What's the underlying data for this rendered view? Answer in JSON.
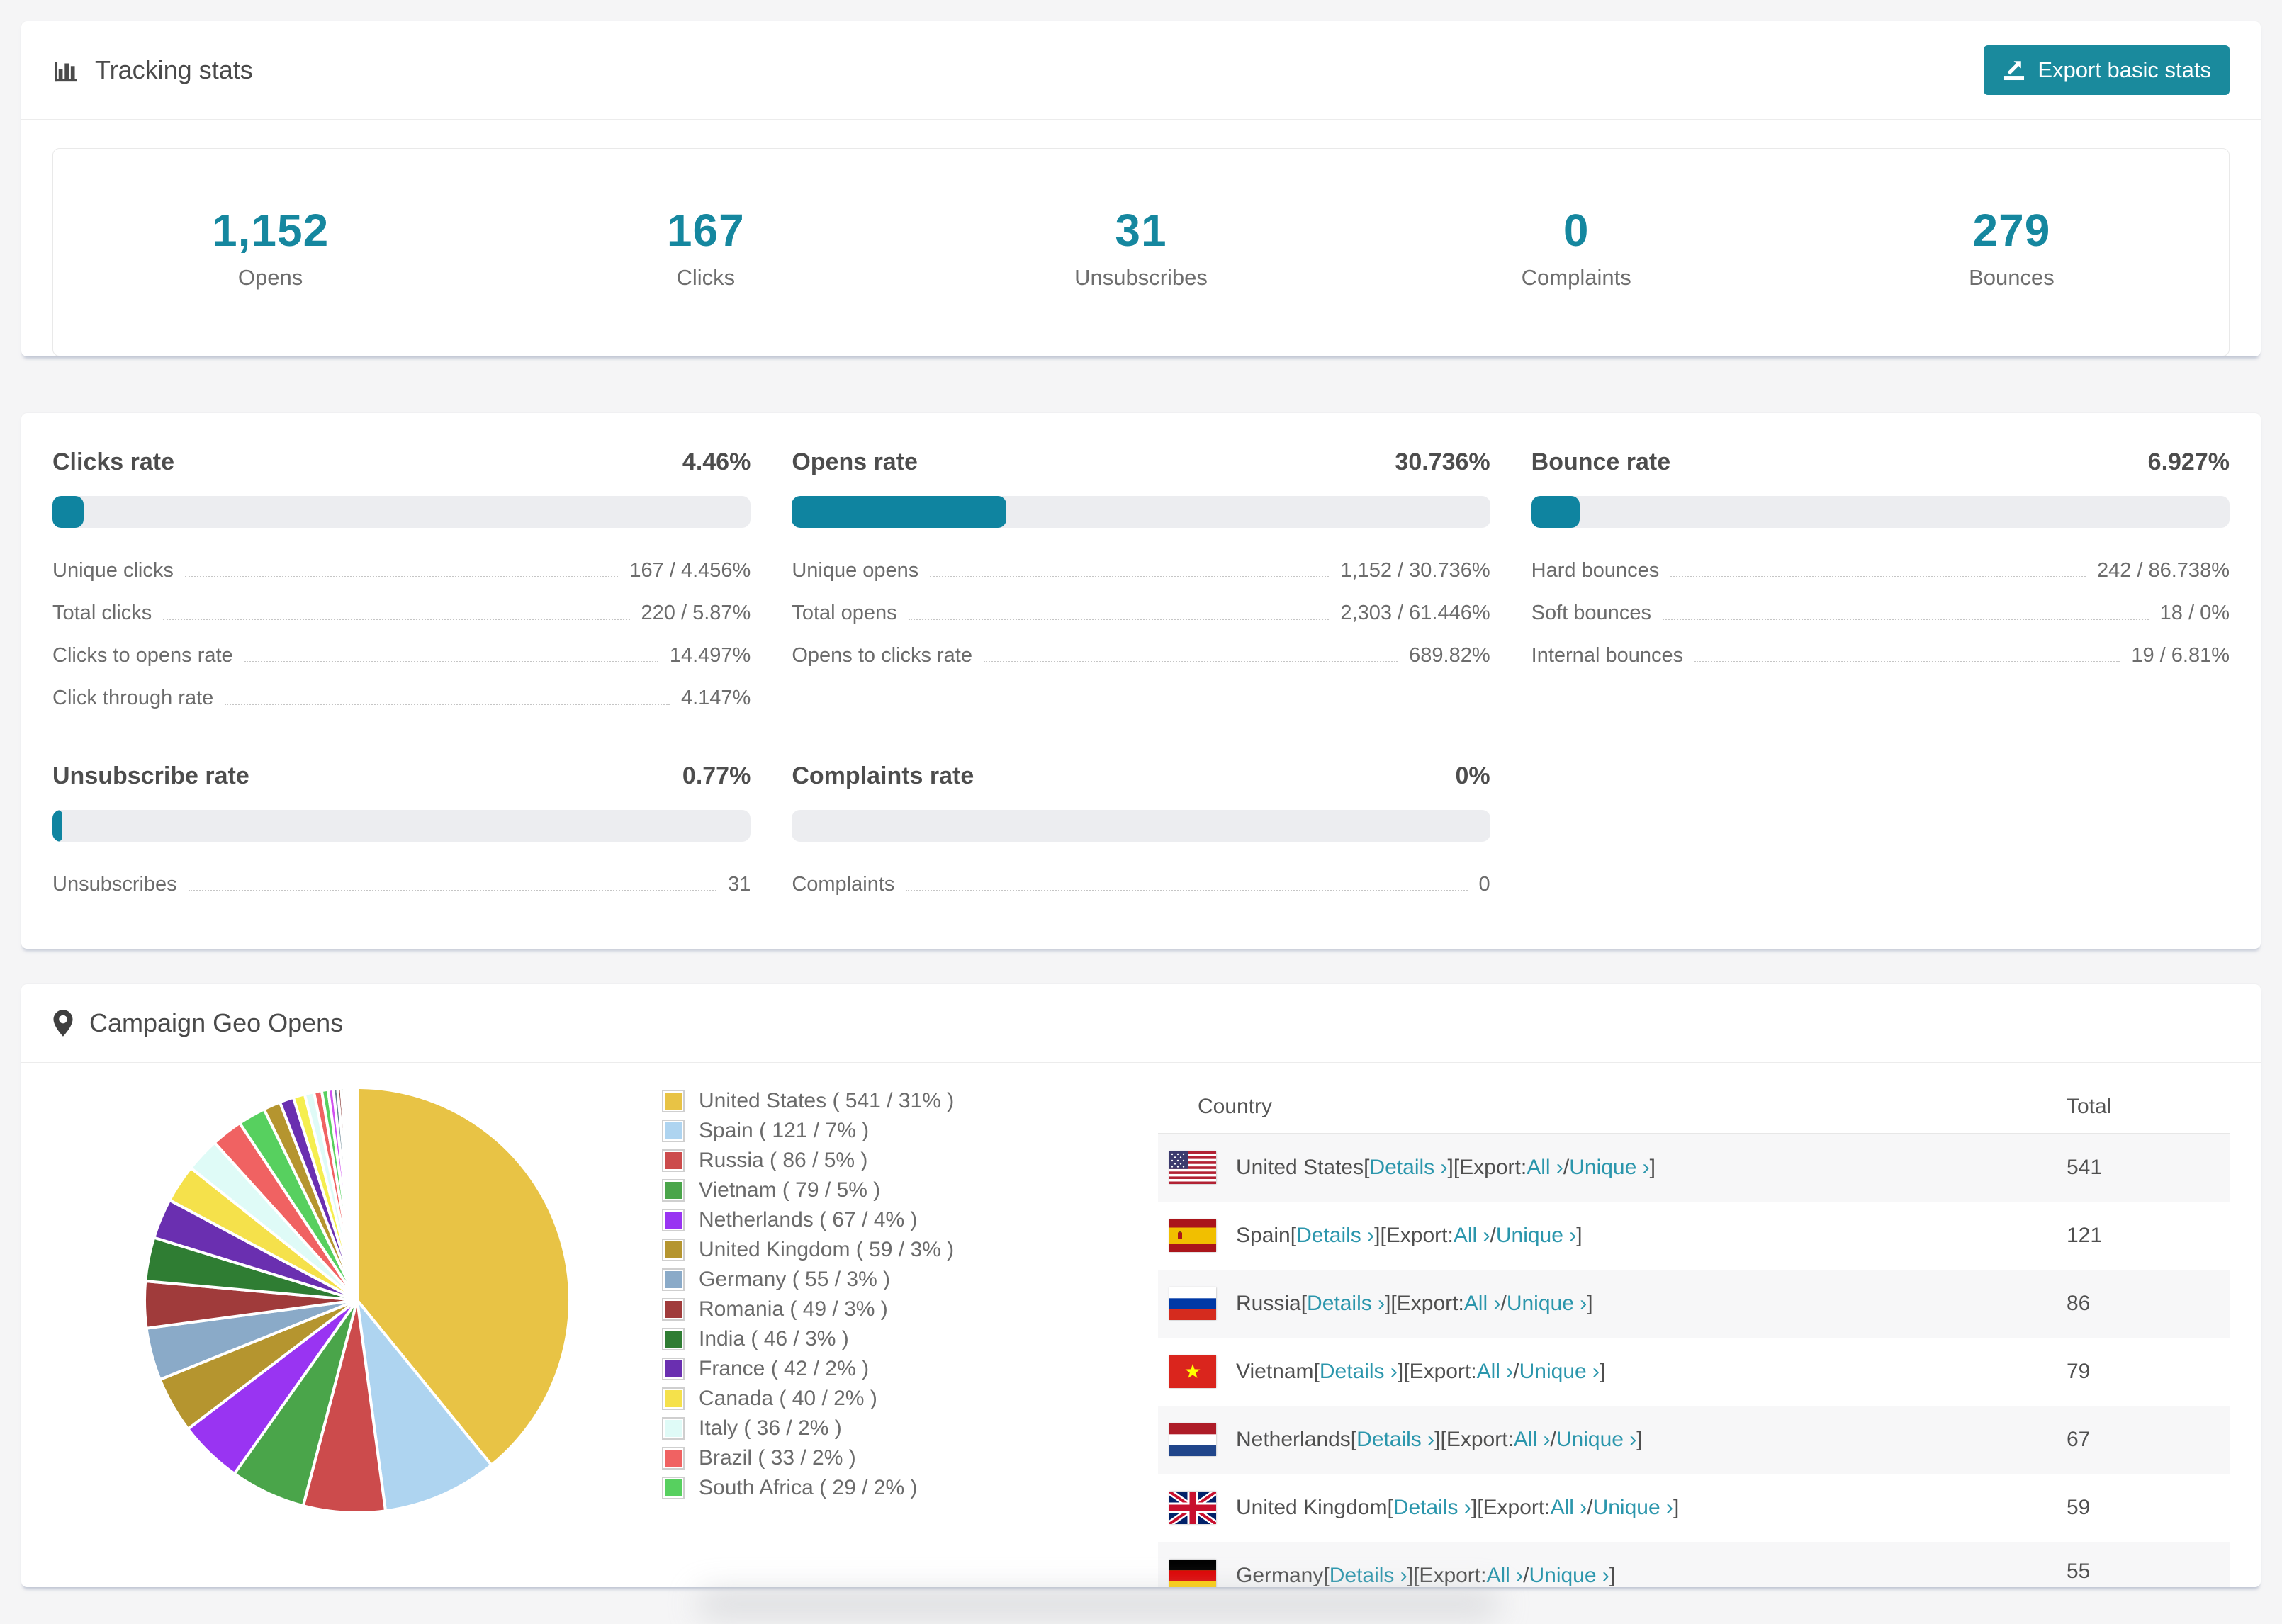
{
  "colors": {
    "accent": "#15879f",
    "button_bg": "#1a8a9d",
    "link": "#2b96ac",
    "bar_fill": "#0f84a0",
    "bar_track": "#ecedf0",
    "row_stripe": "#f7f7f8"
  },
  "tracking": {
    "title": "Tracking stats",
    "export_label": "Export basic stats"
  },
  "summary_stats": [
    {
      "value": "1,152",
      "label": "Opens"
    },
    {
      "value": "167",
      "label": "Clicks"
    },
    {
      "value": "31",
      "label": "Unsubscribes"
    },
    {
      "value": "0",
      "label": "Complaints"
    },
    {
      "value": "279",
      "label": "Bounces"
    }
  ],
  "rate_blocks": [
    {
      "id": "clicks-rate",
      "title": "Clicks rate",
      "value": "4.46%",
      "percent": 4.46,
      "rows": [
        {
          "label": "Unique clicks",
          "value": "167 / 4.456%"
        },
        {
          "label": "Total clicks",
          "value": "220 / 5.87%"
        },
        {
          "label": "Clicks to opens rate",
          "value": "14.497%"
        },
        {
          "label": "Click through rate",
          "value": "4.147%"
        }
      ]
    },
    {
      "id": "opens-rate",
      "title": "Opens rate",
      "value": "30.736%",
      "percent": 30.736,
      "rows": [
        {
          "label": "Unique opens",
          "value": "1,152 / 30.736%"
        },
        {
          "label": "Total opens",
          "value": "2,303 / 61.446%"
        },
        {
          "label": "Opens to clicks rate",
          "value": "689.82%"
        }
      ]
    },
    {
      "id": "bounce-rate",
      "title": "Bounce rate",
      "value": "6.927%",
      "percent": 6.927,
      "rows": [
        {
          "label": "Hard bounces",
          "value": "242 / 86.738%"
        },
        {
          "label": "Soft bounces",
          "value": "18 / 0%"
        },
        {
          "label": "Internal bounces",
          "value": "19 / 6.81%"
        }
      ]
    },
    {
      "id": "unsubscribe-rate",
      "title": "Unsubscribe rate",
      "value": "0.77%",
      "percent": 0.77,
      "rows": [
        {
          "label": "Unsubscribes",
          "value": "31"
        }
      ]
    },
    {
      "id": "complaints-rate",
      "title": "Complaints rate",
      "value": "0%",
      "percent": 0,
      "rows": [
        {
          "label": "Complaints",
          "value": "0"
        }
      ]
    }
  ],
  "geo": {
    "title": "Campaign Geo Opens",
    "table": {
      "country_header": "Country",
      "total_header": "Total",
      "details_label": "Details ›",
      "export_prefix": "[Export: ",
      "all_label": "All ›",
      "unique_label": "Unique ›",
      "rows": [
        {
          "country": "United States",
          "flag": "us",
          "total": "541",
          "partial": false
        },
        {
          "country": "Spain",
          "flag": "es",
          "total": "121",
          "partial": false
        },
        {
          "country": "Russia",
          "flag": "ru",
          "total": "86",
          "partial": false
        },
        {
          "country": "Vietnam",
          "flag": "vn",
          "total": "79",
          "partial": false
        },
        {
          "country": "Netherlands",
          "flag": "nl",
          "total": "67",
          "partial": false
        },
        {
          "country": "United Kingdom",
          "flag": "gb",
          "total": "59",
          "partial": false
        },
        {
          "country": "Germany",
          "flag": "de",
          "total": "55",
          "partial": true
        }
      ]
    }
  },
  "chart_data": {
    "type": "pie",
    "title": "Campaign Geo Opens",
    "legend_position": "right",
    "series": [
      {
        "name": "United States",
        "value": 541,
        "percent": 31,
        "color": "#e8c345"
      },
      {
        "name": "Spain",
        "value": 121,
        "percent": 7,
        "color": "#aed4f0"
      },
      {
        "name": "Russia",
        "value": 86,
        "percent": 5,
        "color": "#cc4b4c"
      },
      {
        "name": "Vietnam",
        "value": 79,
        "percent": 5,
        "color": "#4aa54a"
      },
      {
        "name": "Netherlands",
        "value": 67,
        "percent": 4,
        "color": "#9934f2"
      },
      {
        "name": "United Kingdom",
        "value": 59,
        "percent": 3,
        "color": "#b5952f"
      },
      {
        "name": "Germany",
        "value": 55,
        "percent": 3,
        "color": "#8aaac8"
      },
      {
        "name": "Romania",
        "value": 49,
        "percent": 3,
        "color": "#a03b3b"
      },
      {
        "name": "India",
        "value": 46,
        "percent": 3,
        "color": "#2f7d33"
      },
      {
        "name": "France",
        "value": 42,
        "percent": 2,
        "color": "#6a2fb0"
      },
      {
        "name": "Canada",
        "value": 40,
        "percent": 2,
        "color": "#f5e14b"
      },
      {
        "name": "Italy",
        "value": 36,
        "percent": 2,
        "color": "#dffbf7"
      },
      {
        "name": "Brazil",
        "value": 33,
        "percent": 2,
        "color": "#f06262"
      },
      {
        "name": "South Africa",
        "value": 29,
        "percent": 2,
        "color": "#57d05f"
      }
    ],
    "others": {
      "note": "long tail of additional countries rendered as thin unlabeled slices",
      "slice_count": 35,
      "first_weight": 18,
      "decay": 0.82,
      "tail_colors": [
        "#b5952f",
        "#6a2fb0",
        "#f5ee4f",
        "#dffbf7",
        "#f06262",
        "#57d05f",
        "#cf4ff0",
        "#62808f",
        "#7c2420",
        "#174f22",
        "#392a78",
        "#e8c345",
        "#a03b3b",
        "#8aaac8",
        "#8a7d1e",
        "#b44bf0",
        "#57d05f",
        "#f06262",
        "#aed4f0",
        "#e8c345",
        "#cc4b4c",
        "#2f7d33",
        "#9934f2",
        "#f5ee4f",
        "#62808f",
        "#7c2420",
        "#174f22",
        "#b44bf0",
        "#cf4ff0",
        "#f06262",
        "#aed4f0",
        "#e8c345",
        "#9934f2",
        "#57d05f",
        "#cc4b4c"
      ]
    }
  }
}
